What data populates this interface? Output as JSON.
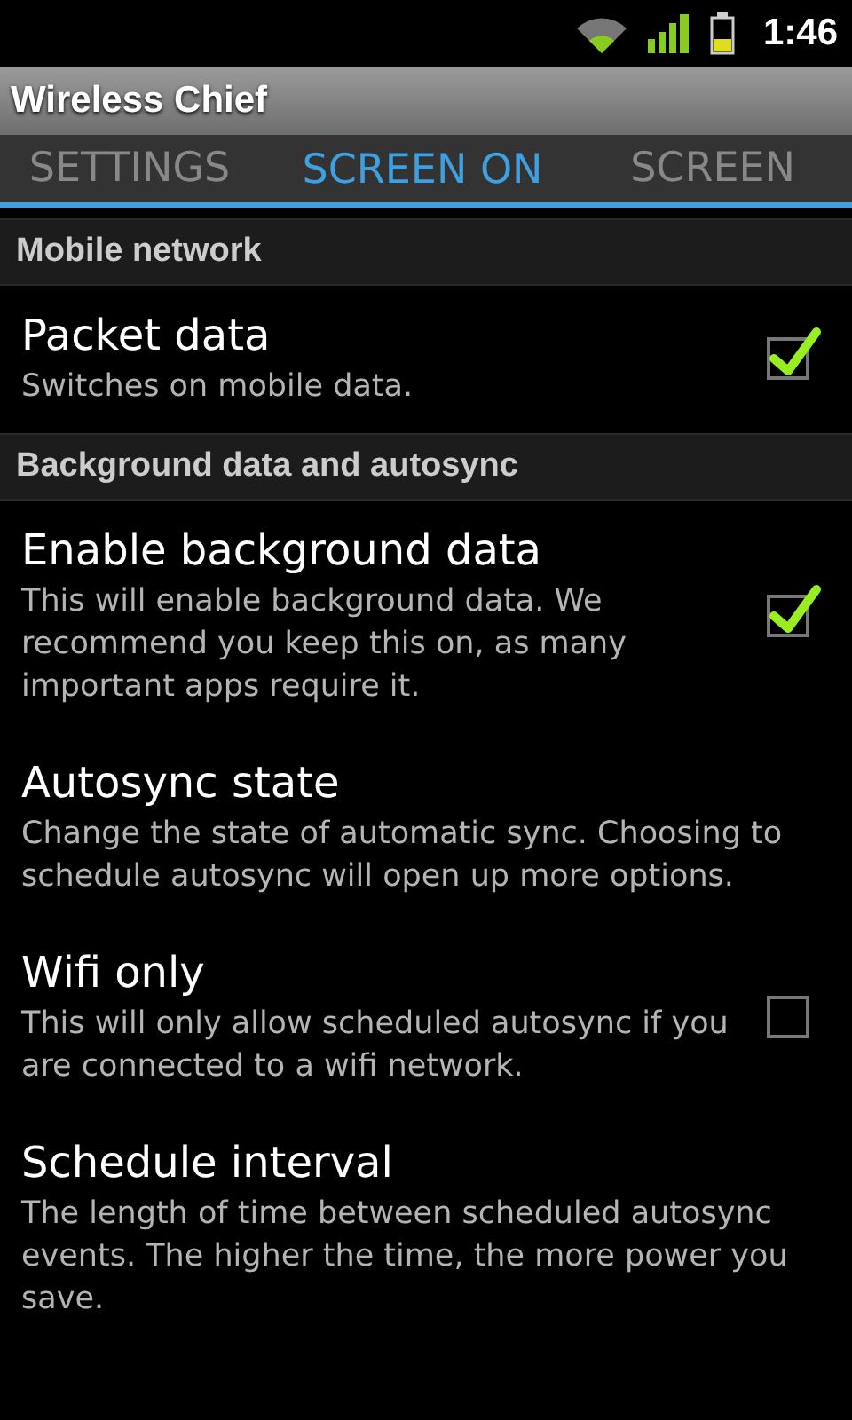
{
  "status_bar": {
    "time": "1:46"
  },
  "window": {
    "title": "Wireless Chief"
  },
  "tabs": [
    {
      "label": "SETTINGS",
      "selected": false
    },
    {
      "label": "SCREEN ON",
      "selected": true
    },
    {
      "label": "SCREEN",
      "selected": false
    }
  ],
  "sections": [
    {
      "header": "Mobile network",
      "items": [
        {
          "kind": "checkbox",
          "title": "Packet data",
          "summary": "Switches on mobile data.",
          "checked": true
        }
      ]
    },
    {
      "header": "Background data and autosync",
      "items": [
        {
          "kind": "checkbox",
          "title": "Enable background data",
          "summary": "This will enable background data. We recommend you keep this on, as many important apps require it.",
          "checked": true
        },
        {
          "kind": "plain",
          "title": "Autosync state",
          "summary": "Change the state of automatic sync. Choosing to schedule autosync will open up more options."
        },
        {
          "kind": "checkbox",
          "title": "Wifi only",
          "summary": "This will only allow scheduled autosync if you are connected to a wifi network.",
          "checked": false
        },
        {
          "kind": "plain",
          "title": "Schedule interval",
          "summary": "The length of time between scheduled autosync events. The higher the time, the more power you save."
        }
      ]
    }
  ]
}
